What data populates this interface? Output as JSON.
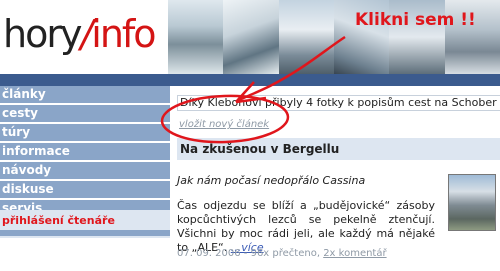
{
  "logo": {
    "part1": "hory",
    "slash": "/",
    "part2": "info"
  },
  "annotation": {
    "text": "Klikni sem !!",
    "color": "#e0161c"
  },
  "colors": {
    "nav_bg": "#8aa5c8",
    "top_bar": "#3b5b8e",
    "panel_bg": "#dde6f1",
    "accent_red": "#d41414"
  },
  "nav": {
    "items": [
      "články",
      "cesty",
      "túry",
      "informace",
      "návody",
      "diskuse",
      "servis"
    ]
  },
  "login": {
    "label": "přihlášení čtenáře"
  },
  "news": {
    "text": "Díky Klebonovi přibyly 4 fotky k popisům cest na Schober"
  },
  "new_article": {
    "label": "vložit nový článek"
  },
  "article": {
    "title": "Na zkušenou v Bergellu",
    "subtitle": "Jak nám počasí nedopřálo Cassina",
    "body": "Čas odjezdu se blíží a „budějovické“ zásoby kopců­chtivých lezců se pekelně ztenčují. Všichni by moc rádi jeli, ale každý má nějaké to „ALE“.",
    "more": "...více",
    "meta": "07. 09. 2006 - 96x přečteno,",
    "comments": "2x komentář"
  }
}
